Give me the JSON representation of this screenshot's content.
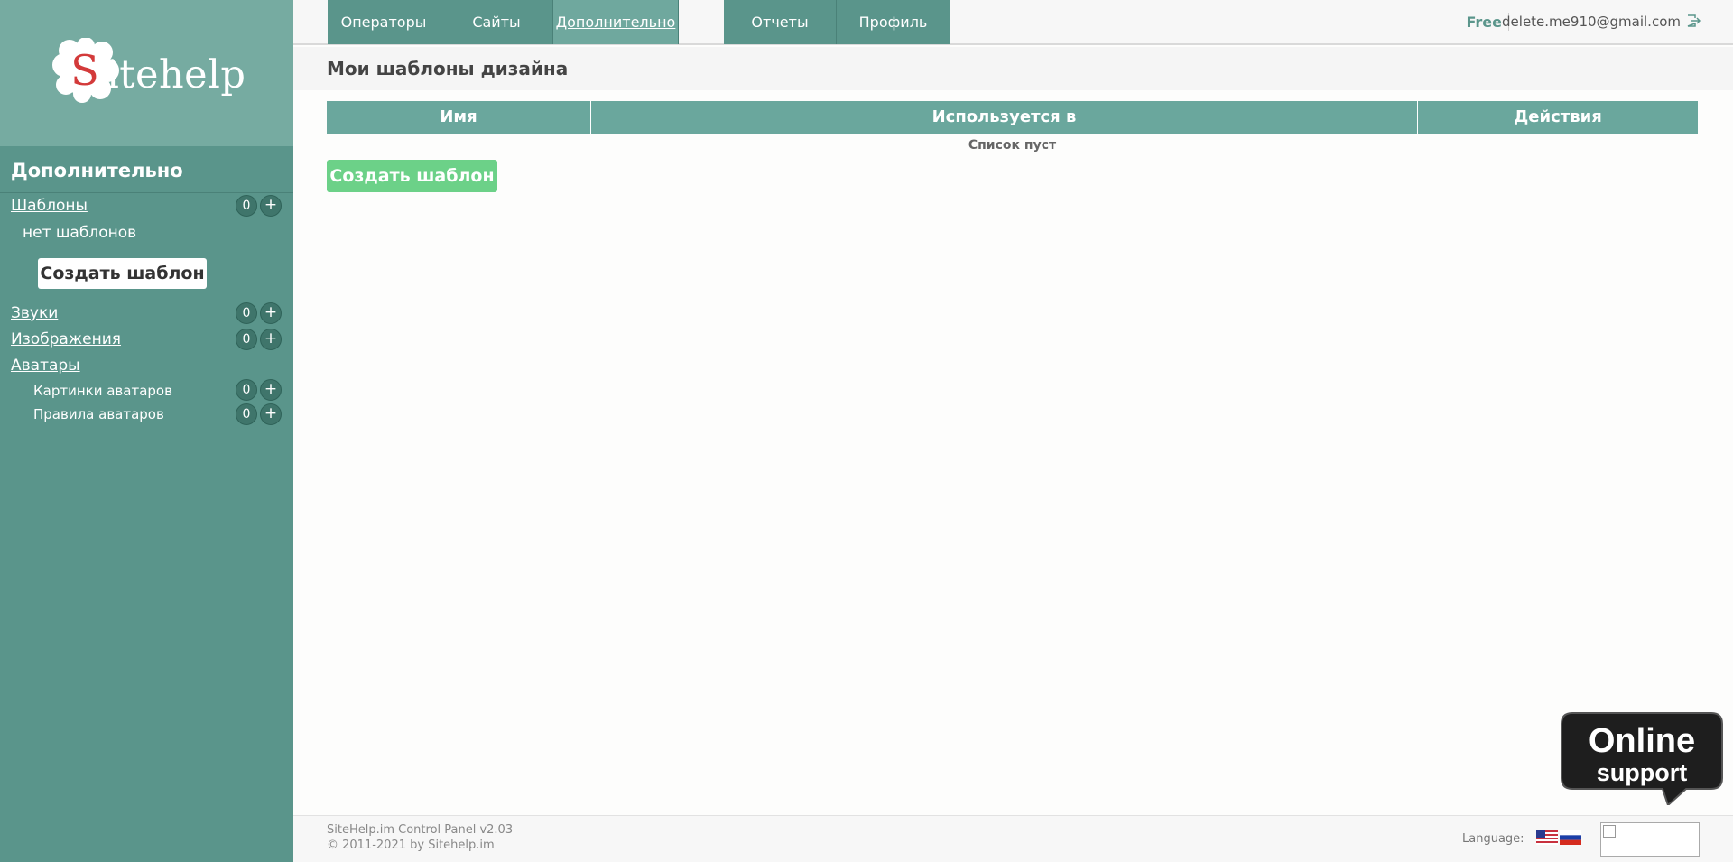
{
  "brand": {
    "logo_letter": "S",
    "logo_text": "itehelp"
  },
  "colors": {
    "sidebar": "#5a958b",
    "accent": "#6aa79d",
    "create_button": "#6cd188"
  },
  "sidebar": {
    "title": "Дополнительно",
    "templates": {
      "label": "Шаблоны",
      "count": "0",
      "plus": "+"
    },
    "no_templates": "нет шаблонов",
    "create_button": "Создать шаблон",
    "sounds": {
      "label": "Звуки",
      "count": "0",
      "plus": "+"
    },
    "images": {
      "label": "Изображения",
      "count": "0",
      "plus": "+"
    },
    "avatars": {
      "label": "Аватары"
    },
    "avatar_pictures": {
      "label": "Картинки аватаров",
      "count": "0",
      "plus": "+"
    },
    "avatar_rules": {
      "label": "Правила аватаров",
      "count": "0",
      "plus": "+"
    }
  },
  "nav": {
    "tabs": [
      {
        "label": "Операторы"
      },
      {
        "label": "Сайты"
      },
      {
        "label": "Дополнительно"
      },
      {
        "label": "Отчеты"
      },
      {
        "label": "Профиль"
      }
    ],
    "plan": "Free",
    "email": "delete.me910@gmail.com",
    "logout_icon": "logout-icon"
  },
  "main": {
    "title": "Мои шаблоны дизайна",
    "columns": [
      "Имя",
      "Используется в",
      "Действия"
    ],
    "empty_text": "Список пуст",
    "create_button": "Создать шаблон"
  },
  "footer": {
    "line1": "SiteHelp.im Control Panel v2.03",
    "line2": "© 2011-2021 by Sitehelp.im",
    "language_label": "Language:",
    "flags": [
      "us-flag-icon",
      "ru-flag-icon"
    ]
  },
  "support": {
    "line1": "Online",
    "line2": "support"
  }
}
